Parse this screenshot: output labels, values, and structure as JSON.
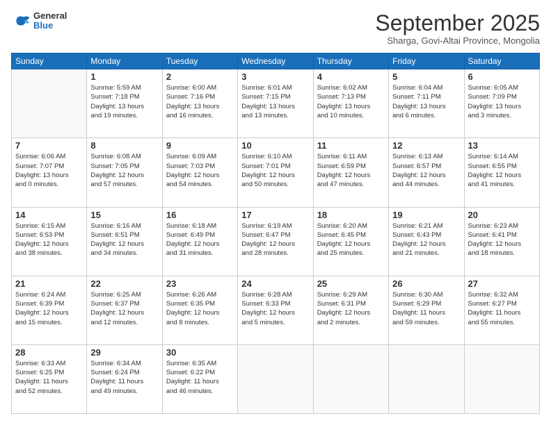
{
  "logo": {
    "general": "General",
    "blue": "Blue"
  },
  "header": {
    "month": "September 2025",
    "location": "Sharga, Govi-Altai Province, Mongolia"
  },
  "days_of_week": [
    "Sunday",
    "Monday",
    "Tuesday",
    "Wednesday",
    "Thursday",
    "Friday",
    "Saturday"
  ],
  "weeks": [
    [
      {
        "day": "",
        "info": ""
      },
      {
        "day": "1",
        "info": "Sunrise: 5:59 AM\nSunset: 7:18 PM\nDaylight: 13 hours\nand 19 minutes."
      },
      {
        "day": "2",
        "info": "Sunrise: 6:00 AM\nSunset: 7:16 PM\nDaylight: 13 hours\nand 16 minutes."
      },
      {
        "day": "3",
        "info": "Sunrise: 6:01 AM\nSunset: 7:15 PM\nDaylight: 13 hours\nand 13 minutes."
      },
      {
        "day": "4",
        "info": "Sunrise: 6:02 AM\nSunset: 7:13 PM\nDaylight: 13 hours\nand 10 minutes."
      },
      {
        "day": "5",
        "info": "Sunrise: 6:04 AM\nSunset: 7:11 PM\nDaylight: 13 hours\nand 6 minutes."
      },
      {
        "day": "6",
        "info": "Sunrise: 6:05 AM\nSunset: 7:09 PM\nDaylight: 13 hours\nand 3 minutes."
      }
    ],
    [
      {
        "day": "7",
        "info": "Sunrise: 6:06 AM\nSunset: 7:07 PM\nDaylight: 13 hours\nand 0 minutes."
      },
      {
        "day": "8",
        "info": "Sunrise: 6:08 AM\nSunset: 7:05 PM\nDaylight: 12 hours\nand 57 minutes."
      },
      {
        "day": "9",
        "info": "Sunrise: 6:09 AM\nSunset: 7:03 PM\nDaylight: 12 hours\nand 54 minutes."
      },
      {
        "day": "10",
        "info": "Sunrise: 6:10 AM\nSunset: 7:01 PM\nDaylight: 12 hours\nand 50 minutes."
      },
      {
        "day": "11",
        "info": "Sunrise: 6:11 AM\nSunset: 6:59 PM\nDaylight: 12 hours\nand 47 minutes."
      },
      {
        "day": "12",
        "info": "Sunrise: 6:13 AM\nSunset: 6:57 PM\nDaylight: 12 hours\nand 44 minutes."
      },
      {
        "day": "13",
        "info": "Sunrise: 6:14 AM\nSunset: 6:55 PM\nDaylight: 12 hours\nand 41 minutes."
      }
    ],
    [
      {
        "day": "14",
        "info": "Sunrise: 6:15 AM\nSunset: 6:53 PM\nDaylight: 12 hours\nand 38 minutes."
      },
      {
        "day": "15",
        "info": "Sunrise: 6:16 AM\nSunset: 6:51 PM\nDaylight: 12 hours\nand 34 minutes."
      },
      {
        "day": "16",
        "info": "Sunrise: 6:18 AM\nSunset: 6:49 PM\nDaylight: 12 hours\nand 31 minutes."
      },
      {
        "day": "17",
        "info": "Sunrise: 6:19 AM\nSunset: 6:47 PM\nDaylight: 12 hours\nand 28 minutes."
      },
      {
        "day": "18",
        "info": "Sunrise: 6:20 AM\nSunset: 6:45 PM\nDaylight: 12 hours\nand 25 minutes."
      },
      {
        "day": "19",
        "info": "Sunrise: 6:21 AM\nSunset: 6:43 PM\nDaylight: 12 hours\nand 21 minutes."
      },
      {
        "day": "20",
        "info": "Sunrise: 6:23 AM\nSunset: 6:41 PM\nDaylight: 12 hours\nand 18 minutes."
      }
    ],
    [
      {
        "day": "21",
        "info": "Sunrise: 6:24 AM\nSunset: 6:39 PM\nDaylight: 12 hours\nand 15 minutes."
      },
      {
        "day": "22",
        "info": "Sunrise: 6:25 AM\nSunset: 6:37 PM\nDaylight: 12 hours\nand 12 minutes."
      },
      {
        "day": "23",
        "info": "Sunrise: 6:26 AM\nSunset: 6:35 PM\nDaylight: 12 hours\nand 8 minutes."
      },
      {
        "day": "24",
        "info": "Sunrise: 6:28 AM\nSunset: 6:33 PM\nDaylight: 12 hours\nand 5 minutes."
      },
      {
        "day": "25",
        "info": "Sunrise: 6:29 AM\nSunset: 6:31 PM\nDaylight: 12 hours\nand 2 minutes."
      },
      {
        "day": "26",
        "info": "Sunrise: 6:30 AM\nSunset: 6:29 PM\nDaylight: 11 hours\nand 59 minutes."
      },
      {
        "day": "27",
        "info": "Sunrise: 6:32 AM\nSunset: 6:27 PM\nDaylight: 11 hours\nand 55 minutes."
      }
    ],
    [
      {
        "day": "28",
        "info": "Sunrise: 6:33 AM\nSunset: 6:25 PM\nDaylight: 11 hours\nand 52 minutes."
      },
      {
        "day": "29",
        "info": "Sunrise: 6:34 AM\nSunset: 6:24 PM\nDaylight: 11 hours\nand 49 minutes."
      },
      {
        "day": "30",
        "info": "Sunrise: 6:35 AM\nSunset: 6:22 PM\nDaylight: 11 hours\nand 46 minutes."
      },
      {
        "day": "",
        "info": ""
      },
      {
        "day": "",
        "info": ""
      },
      {
        "day": "",
        "info": ""
      },
      {
        "day": "",
        "info": ""
      }
    ]
  ]
}
